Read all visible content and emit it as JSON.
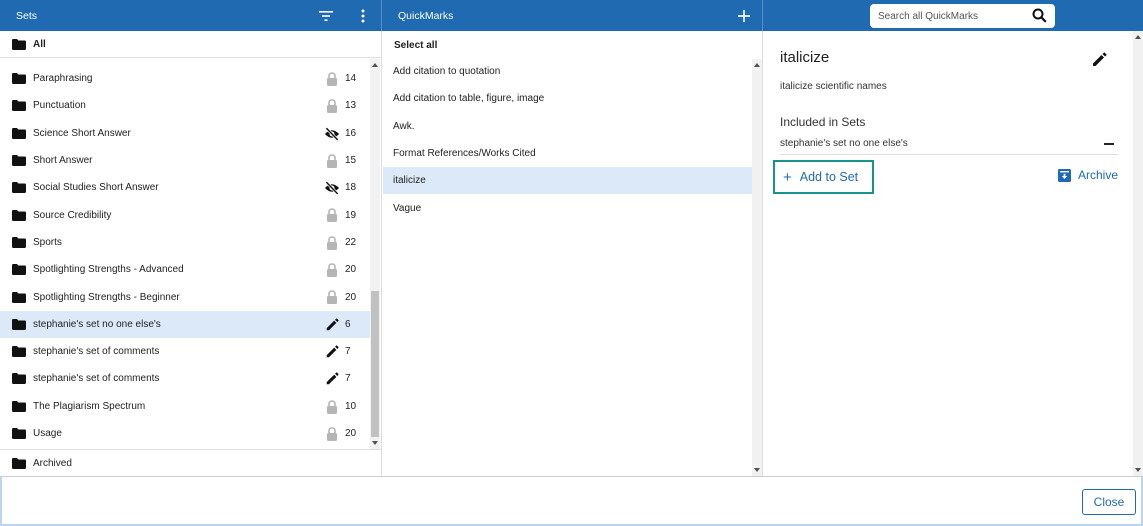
{
  "sets_panel": {
    "title": "Sets",
    "all_label": "All",
    "archived_label": "Archived",
    "items": [
      {
        "label": "Paraphrasing",
        "status": "lock-icon",
        "count": "14",
        "selected": false
      },
      {
        "label": "Punctuation",
        "status": "lock-icon",
        "count": "13",
        "selected": false
      },
      {
        "label": "Science Short Answer",
        "status": "eye-off-icon",
        "count": "16",
        "selected": false
      },
      {
        "label": "Short Answer",
        "status": "lock-icon",
        "count": "15",
        "selected": false
      },
      {
        "label": "Social Studies Short Answer",
        "status": "eye-off-icon",
        "count": "18",
        "selected": false
      },
      {
        "label": "Source Credibility",
        "status": "lock-icon",
        "count": "19",
        "selected": false
      },
      {
        "label": "Sports",
        "status": "lock-icon",
        "count": "22",
        "selected": false
      },
      {
        "label": "Spotlighting Strengths - Advanced",
        "status": "lock-icon",
        "count": "20",
        "selected": false
      },
      {
        "label": "Spotlighting Strengths - Beginner",
        "status": "lock-icon",
        "count": "20",
        "selected": false
      },
      {
        "label": "stephanie's set no one else's",
        "status": "pencil-icon",
        "count": "6",
        "selected": true
      },
      {
        "label": "stephanie's set of comments",
        "status": "pencil-icon",
        "count": "7",
        "selected": false
      },
      {
        "label": "stephanie's set of comments",
        "status": "pencil-icon",
        "count": "7",
        "selected": false
      },
      {
        "label": "The Plagiarism Spectrum",
        "status": "lock-icon",
        "count": "10",
        "selected": false
      },
      {
        "label": "Usage",
        "status": "lock-icon",
        "count": "20",
        "selected": false
      }
    ]
  },
  "quickmarks_panel": {
    "title": "QuickMarks",
    "select_all_label": "Select all",
    "items": [
      {
        "label": "Add citation to quotation",
        "selected": false
      },
      {
        "label": "Add citation to table, figure, image",
        "selected": false
      },
      {
        "label": "Awk.",
        "selected": false
      },
      {
        "label": "Format References/Works Cited",
        "selected": false
      },
      {
        "label": "italicize",
        "selected": true
      },
      {
        "label": "Vague",
        "selected": false
      }
    ]
  },
  "search": {
    "placeholder": "Search all QuickMarks",
    "value": ""
  },
  "detail": {
    "title": "italicize",
    "description": "italicize scientific names",
    "included_heading": "Included in Sets",
    "included_sets": [
      "stephanie's set no one else's"
    ],
    "add_to_set_label": "Add to Set",
    "archive_label": "Archive"
  },
  "footer": {
    "close_label": "Close"
  },
  "colors": {
    "header_blue": "#1f6ab0",
    "selected_row": "#dbe9f9",
    "focus_teal": "#17928f"
  }
}
